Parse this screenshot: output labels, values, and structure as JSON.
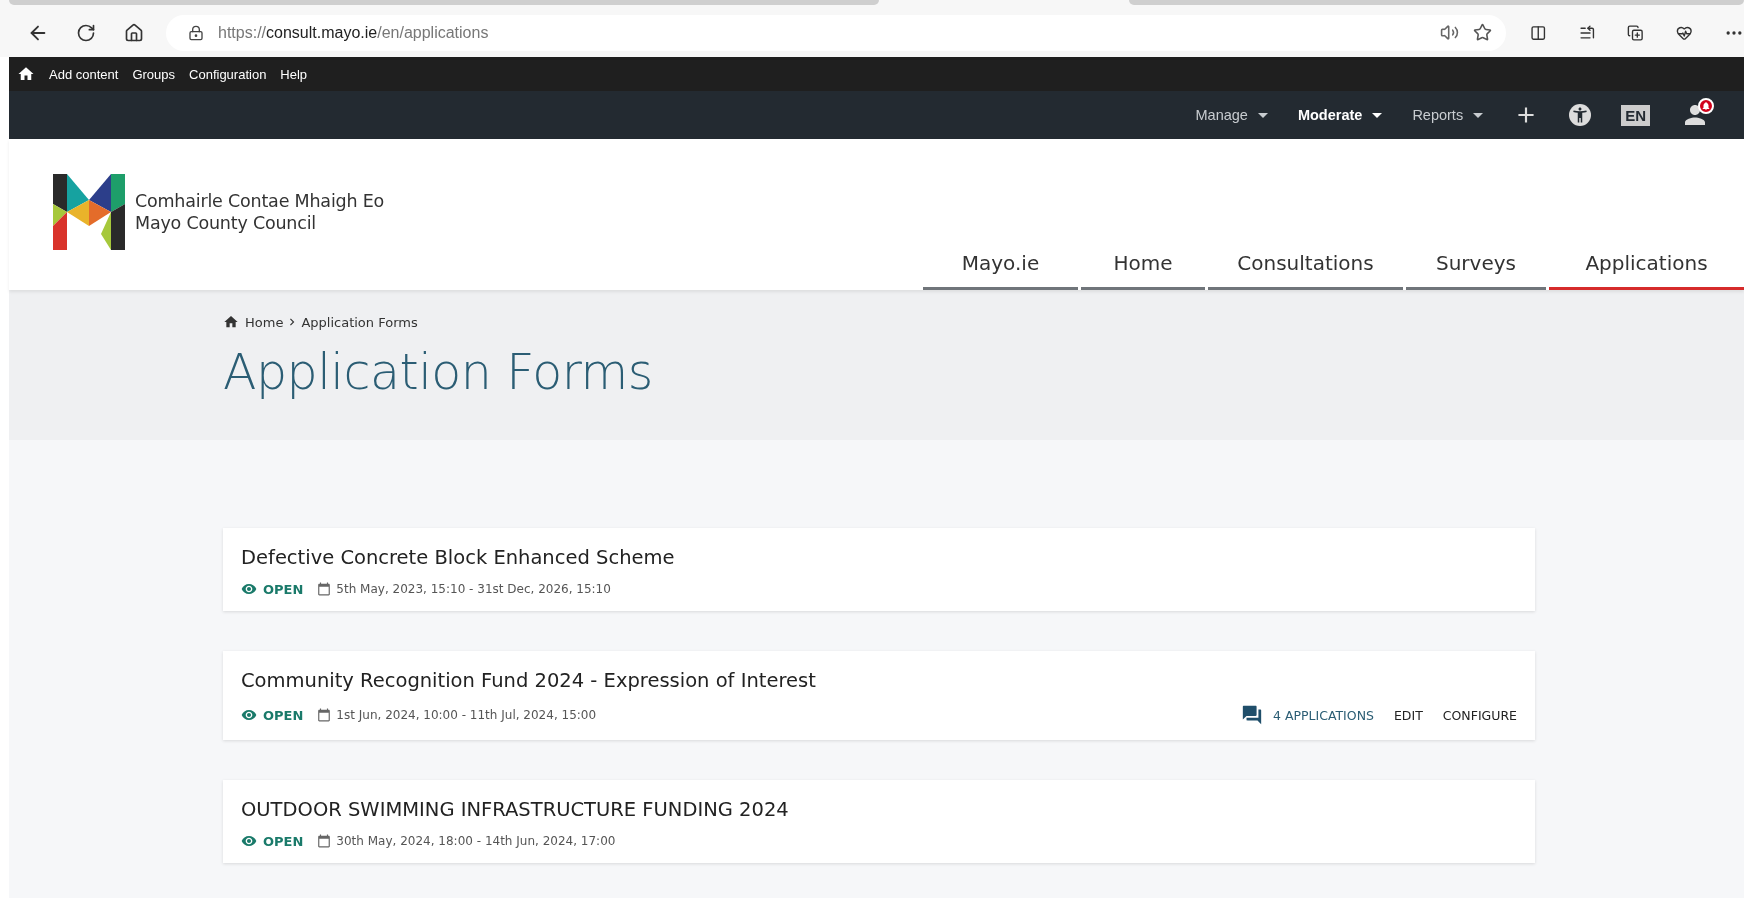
{
  "browser": {
    "url_parts": [
      {
        "text": "https://",
        "emphasis": false
      },
      {
        "text": "consult.mayo.ie",
        "emphasis": true
      },
      {
        "text": "/en/applications",
        "emphasis": false
      }
    ]
  },
  "admin_toolbar": {
    "items": [
      "Add content",
      "Groups",
      "Configuration",
      "Help"
    ]
  },
  "secondary_toolbar": {
    "menus": [
      {
        "label": "Manage",
        "selected": false
      },
      {
        "label": "Moderate",
        "selected": true
      },
      {
        "label": "Reports",
        "selected": false
      }
    ],
    "language": "EN",
    "has_notification": true
  },
  "site_header": {
    "logo_lines": [
      "Comhairle Contae Mhaigh Eo",
      "Mayo County Council"
    ],
    "nav": [
      {
        "label": "Mayo.ie",
        "selected": false
      },
      {
        "label": "Home",
        "selected": false
      },
      {
        "label": "Consultations",
        "selected": false
      },
      {
        "label": "Surveys",
        "selected": false
      },
      {
        "label": "Applications",
        "selected": true
      }
    ]
  },
  "breadcrumb": [
    "Home",
    "Application Forms"
  ],
  "page_title": "Application Forms",
  "forms": [
    {
      "title": "Defective Concrete Block Enhanced Scheme",
      "status": "OPEN",
      "dates": "5th May, 2023, 15:10 - 31st Dec, 2026, 15:10"
    },
    {
      "title": "Community Recognition Fund 2024 - Expression of Interest",
      "status": "OPEN",
      "dates": "1st Jun, 2024, 10:00 - 11th Jul, 2024, 15:00",
      "actions": [
        {
          "kind": "count",
          "label": "4 APPLICATIONS"
        },
        {
          "kind": "link",
          "label": "EDIT"
        },
        {
          "kind": "link",
          "label": "CONFIGURE"
        }
      ]
    },
    {
      "title": "OUTDOOR SWIMMING INFRASTRUCTURE FUNDING 2024",
      "status": "OPEN",
      "dates": "30th May, 2024, 18:00 - 14th Jun, 2024, 17:00"
    }
  ]
}
